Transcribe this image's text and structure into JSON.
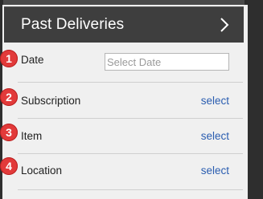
{
  "header": {
    "title": "Past Deliveries",
    "icon": "chevron-right-icon"
  },
  "steps": [
    "1",
    "2",
    "3",
    "4"
  ],
  "fields": {
    "date": {
      "label": "Date",
      "placeholder": "Select Date",
      "value": ""
    },
    "subscription": {
      "label": "Subscription",
      "link": "select"
    },
    "item": {
      "label": "Item",
      "link": "select"
    },
    "location": {
      "label": "Location",
      "link": "select"
    }
  },
  "colors": {
    "header_bg": "#3e3e3e",
    "badge": "#e23a3a",
    "link": "#2a5db0"
  }
}
